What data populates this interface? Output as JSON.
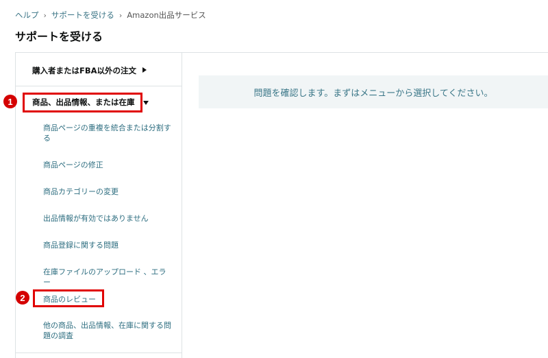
{
  "breadcrumb": {
    "items": [
      "ヘルプ",
      "サポートを受ける",
      "Amazon出品サービス"
    ],
    "separator": "›"
  },
  "page_title": "サポートを受ける",
  "sidebar": {
    "categories": [
      {
        "label": "購入者またはFBA以外の注文",
        "state": "collapsed"
      },
      {
        "label": "商品、出品情報、または在庫",
        "state": "expanded"
      }
    ],
    "sub_items": [
      "商品ページの重複を統合または分割する",
      "商品ページの修正",
      "商品カテゴリーの変更",
      "出品情報が有効ではありません",
      "商品登録に関する問題",
      "在庫ファイルのアップロード 、エラー",
      "商品のレビュー",
      "他の商品、出品情報、在庫に関する問題の調査"
    ]
  },
  "annotations": {
    "badge_1": "1",
    "badge_2": "2"
  },
  "notice": {
    "text": "問題を確認します。まずはメニューから選択してください。"
  },
  "colors": {
    "highlight": "#e00000",
    "link": "#2e6e80",
    "notice_bg": "#f1f5f6"
  }
}
